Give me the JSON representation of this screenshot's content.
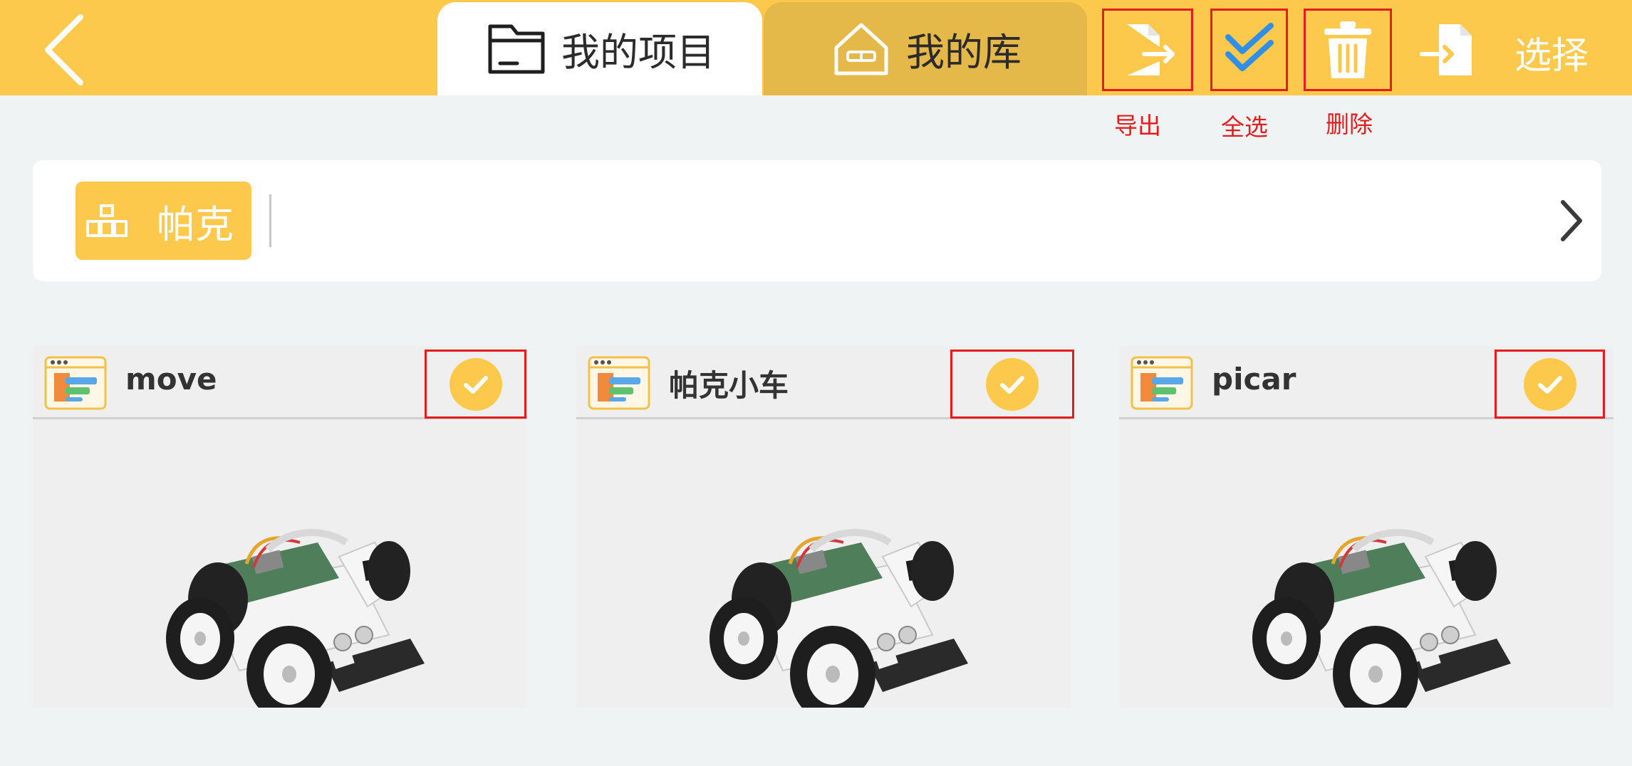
{
  "header": {
    "tabs": [
      {
        "label": "我的项目",
        "active": true
      },
      {
        "label": "我的库",
        "active": false
      }
    ],
    "tools": [
      {
        "icon": "export-icon",
        "label": "导出"
      },
      {
        "icon": "select-all-check-icon",
        "label": "全选"
      },
      {
        "icon": "trash-icon",
        "label": "删除"
      },
      {
        "icon": "import-icon",
        "label": ""
      }
    ],
    "select_label": "选择"
  },
  "filter": {
    "chip_label": "帕克",
    "chip_icon": "hierarchy-icon"
  },
  "projects": [
    {
      "title": "move",
      "selected": true,
      "image": "robot-car-image"
    },
    {
      "title": "帕克小车",
      "selected": true,
      "image": "robot-car-image"
    },
    {
      "title": "picar",
      "selected": true,
      "image": "robot-car-image"
    }
  ],
  "colors": {
    "accent": "#fdc94d",
    "accent_dark": "#e5b84a",
    "annotation_red": "#e31d1d",
    "check_blue": "#2f8ee8",
    "background": "#eff3f4"
  }
}
